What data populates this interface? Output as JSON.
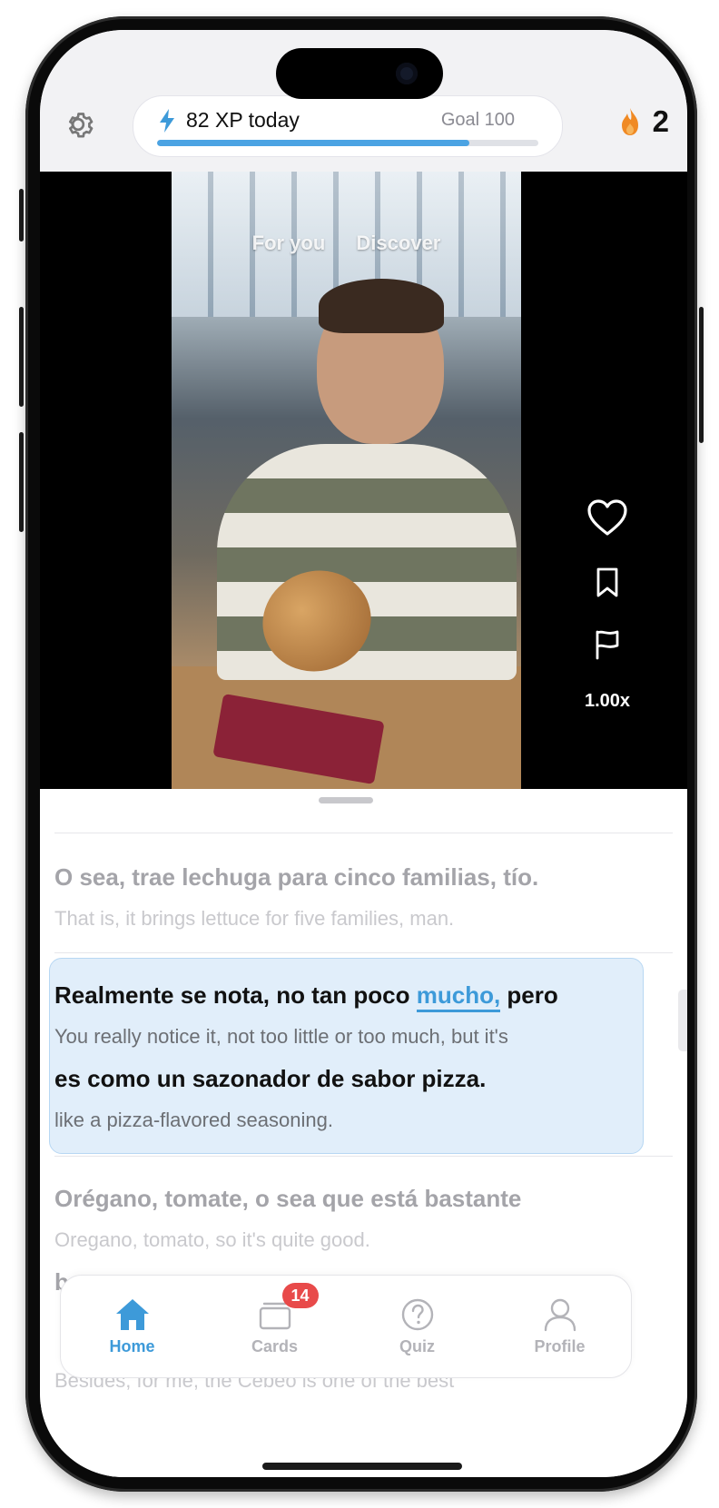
{
  "header": {
    "xp_text": "82 XP today",
    "goal_text": "Goal 100",
    "xp_progress": 0.82,
    "streak_count": "2",
    "accent_color": "#4ba3e3",
    "streak_color": "#f08a24"
  },
  "video": {
    "tabs": [
      "For you",
      "Discover"
    ],
    "speed": "1.00x",
    "icons": [
      "heart-icon",
      "bookmark-icon",
      "flag-icon"
    ]
  },
  "transcript": {
    "lines": [
      {
        "es": "O sea, trae lechuga para cinco familias, tío.",
        "en": "That is, it brings lettuce for five families, man."
      },
      {
        "es_before": "Realmente se nota, no tan poco ",
        "es_highlight": "mucho,",
        "es_after": " pero",
        "en": "You really notice it, not too little or too much, but it's",
        "es2": "es como un sazonador de sabor pizza.",
        "en2": "like a pizza-flavored seasoning."
      },
      {
        "es": "Orégano, tomate, o sea que está bastante",
        "en": "Oregano, tomato, so it's quite good.",
        "es2": "bueno."
      }
    ],
    "peek_text": "Besides, for me, the Cebeo is one of the best"
  },
  "tabbar": {
    "items": [
      {
        "label": "Home",
        "icon": "home-icon",
        "active": true
      },
      {
        "label": "Cards",
        "icon": "cards-icon",
        "badge": "14"
      },
      {
        "label": "Quiz",
        "icon": "quiz-icon"
      },
      {
        "label": "Profile",
        "icon": "profile-icon"
      }
    ]
  }
}
